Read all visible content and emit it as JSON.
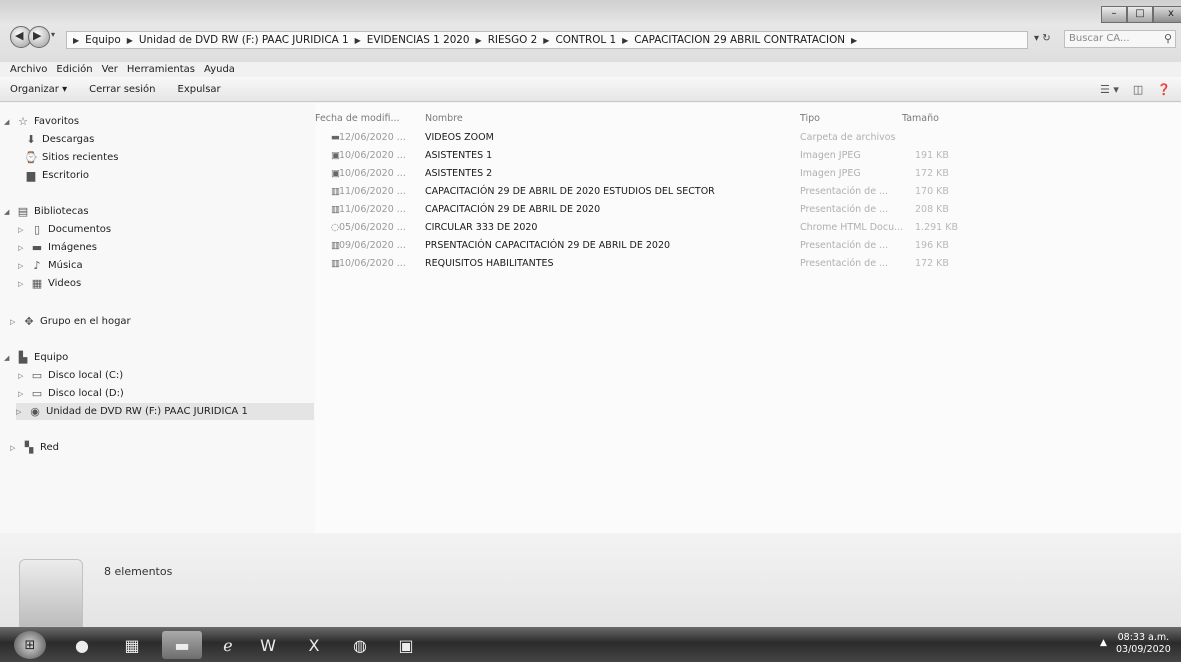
{
  "address_bar": {
    "breadcrumbs": [
      "Equipo",
      "Unidad de DVD RW (F:) PAAC JURIDICA 1",
      "EVIDENCIAS 1 2020",
      "RIESGO 2",
      "CONTROL 1",
      "CAPACITACION 29 ABRIL CONTRATACION"
    ]
  },
  "search": {
    "placeholder": "Buscar CA..."
  },
  "window_controls": {
    "minimize": "–",
    "maximize": "□",
    "close": "x"
  },
  "menu": [
    "Archivo",
    "Edición",
    "Ver",
    "Herramientas",
    "Ayuda"
  ],
  "toolbar": {
    "organize": "Organizar ▾",
    "logoff": "Cerrar sesión",
    "eject": "Expulsar"
  },
  "nav": {
    "favorites": {
      "label": "Favoritos",
      "items": [
        "Descargas",
        "Sitios recientes",
        "Escritorio"
      ]
    },
    "libraries": {
      "label": "Bibliotecas",
      "items": [
        "Documentos",
        "Imágenes",
        "Música",
        "Videos"
      ]
    },
    "homegroup": "Grupo en el hogar",
    "computer": {
      "label": "Equipo",
      "items": [
        "Disco local (C:)",
        "Disco local (D:)",
        "Unidad de DVD RW (F:) PAAC JURIDICA 1"
      ]
    },
    "network": "Red"
  },
  "columns": {
    "date": "Fecha de modifi...",
    "name": "Nombre",
    "type": "Tipo",
    "size": "Tamaño"
  },
  "files": [
    {
      "date": "12/06/2020 ...",
      "name": "VIDEOS ZOOM",
      "type": "Carpeta de archivos",
      "size": "",
      "icon": "folder-icon"
    },
    {
      "date": "10/06/2020 ...",
      "name": "ASISTENTES 1",
      "type": "Imagen JPEG",
      "size": "191 KB",
      "icon": "image-file-icon"
    },
    {
      "date": "10/06/2020 ...",
      "name": "ASISTENTES 2",
      "type": "Imagen JPEG",
      "size": "172 KB",
      "icon": "image-file-icon"
    },
    {
      "date": "11/06/2020 ...",
      "name": "CAPACITACIÓN 29 DE ABRIL DE 2020 ESTUDIOS DEL SECTOR",
      "type": "Presentación de ...",
      "size": "170 KB",
      "icon": "presentation-file-icon"
    },
    {
      "date": "11/06/2020 ...",
      "name": "CAPACITACIÓN 29 DE ABRIL DE 2020",
      "type": "Presentación de ...",
      "size": "208 KB",
      "icon": "presentation-file-icon"
    },
    {
      "date": "05/06/2020 ...",
      "name": "CIRCULAR 333 DE 2020",
      "type": "Chrome HTML Docu...",
      "size": "1.291 KB",
      "icon": "html-file-icon"
    },
    {
      "date": "09/06/2020 ...",
      "name": "PRSENTACIÓN CAPACITACIÓN 29 DE ABRIL DE 2020",
      "type": "Presentación de ...",
      "size": "196 KB",
      "icon": "presentation-file-icon"
    },
    {
      "date": "10/06/2020 ...",
      "name": "REQUISITOS HABILITANTES",
      "type": "Presentación de ...",
      "size": "172 KB",
      "icon": "presentation-file-icon"
    }
  ],
  "status": {
    "count": "8 elementos"
  },
  "taskbar": {
    "apps": [
      "windows-start-icon",
      "media-player-icon",
      "calculator-icon",
      "explorer-icon",
      "internet-explorer-icon",
      "word-icon",
      "excel-icon",
      "chrome-icon",
      "video-icon"
    ],
    "time": "08:33 a.m.",
    "date": "03/09/2020"
  }
}
